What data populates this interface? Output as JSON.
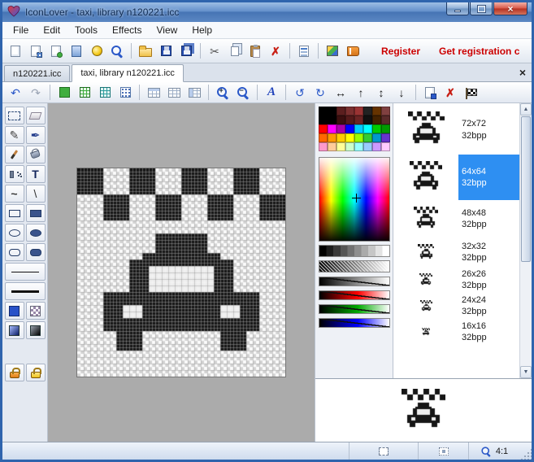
{
  "window": {
    "title": "IconLover - taxi, library n120221.icc"
  },
  "menu": {
    "items": [
      "File",
      "Edit",
      "Tools",
      "Effects",
      "View",
      "Help"
    ]
  },
  "toolbar": {
    "register_label": "Register",
    "get_registration_label": "Get registration c"
  },
  "tabs": [
    {
      "label": "n120221.icc",
      "active": false
    },
    {
      "label": "taxi, library n120221.icc",
      "active": true
    }
  ],
  "icons": {
    "undo": "↶",
    "redo": "↷",
    "cut": "✂",
    "delete": "✗",
    "zoom_in_sign": "+",
    "zoom_out_sign": "−",
    "letter_a": "A",
    "rotate_left": "↺",
    "rotate_right": "↻",
    "flip_horizontal": "↔",
    "arrow_up": "↑",
    "flip_vertical": "↕",
    "arrow_down": "↓",
    "pencil": "✎",
    "pen": "✒",
    "text_tool": "T",
    "curve_tool": "~",
    "line_tool": "\\",
    "scroll_up": "▲",
    "scroll_down": "▼",
    "tab_close": "×",
    "window_close": "×"
  },
  "palette": {
    "colors": [
      "#000000",
      "#5b1f1f",
      "#7a2f2f",
      "#993333",
      "#222222",
      "#663300",
      "#804040",
      "#3b0f0f",
      "#551a1a",
      "#6b2424",
      "#111111",
      "#442200",
      "#5a2a2a",
      "#ff0000",
      "#ff00ff",
      "#aa00aa",
      "#0000ff",
      "#00ccff",
      "#00ffff",
      "#00cc00",
      "#009900",
      "#ff6600",
      "#ff9900",
      "#ffcc00",
      "#ffff00",
      "#99ff00",
      "#33cc33",
      "#0099cc",
      "#6633cc",
      "#ff99cc",
      "#ffcc99",
      "#ffff99",
      "#ccffcc",
      "#99ffff",
      "#99ccff",
      "#cc99ff",
      "#ffccff"
    ]
  },
  "canvas": {
    "ink": "#161616",
    "light": "#eeeeee",
    "pixel_art": [
      "####....####....####....####....",
      "####....####....####....####....",
      "####....####....####....####....",
      "####....####....####....####....",
      "....####....####....####....####",
      "....####....####....####....####",
      "....####....####....####....####",
      "....####....####....####....####",
      "................................",
      "................................",
      "............########............",
      "............########............",
      "............########............",
      "..........############..........",
      "........################........",
      "........###oooooooooo###........",
      "........###oooooooooo###........",
      "........###oooooooooo###........",
      "........###oooooooooo###........",
      "....########################....",
      "....########################....",
      "....###ooo############ooo###....",
      "....###ooo############ooo###....",
      "....########################....",
      "....########################....",
      "......####............####......",
      "......####............####......",
      "......####............####......",
      "................................",
      "................................",
      "................................",
      "................................"
    ]
  },
  "icon_sizes": [
    {
      "label": "72x72",
      "depth": "32bpp",
      "n": 72,
      "selected": false
    },
    {
      "label": "64x64",
      "depth": "32bpp",
      "n": 64,
      "selected": true
    },
    {
      "label": "48x48",
      "depth": "32bpp",
      "n": 48,
      "selected": false
    },
    {
      "label": "32x32",
      "depth": "32bpp",
      "n": 32,
      "selected": false
    },
    {
      "label": "26x26",
      "depth": "32bpp",
      "n": 26,
      "selected": false
    },
    {
      "label": "24x24",
      "depth": "32bpp",
      "n": 24,
      "selected": false
    },
    {
      "label": "16x16",
      "depth": "32bpp",
      "n": 16,
      "selected": false
    }
  ],
  "statusbar": {
    "zoom": "4:1"
  },
  "colors": {
    "selection": "#2e8ff2",
    "register": "#cc0000"
  }
}
